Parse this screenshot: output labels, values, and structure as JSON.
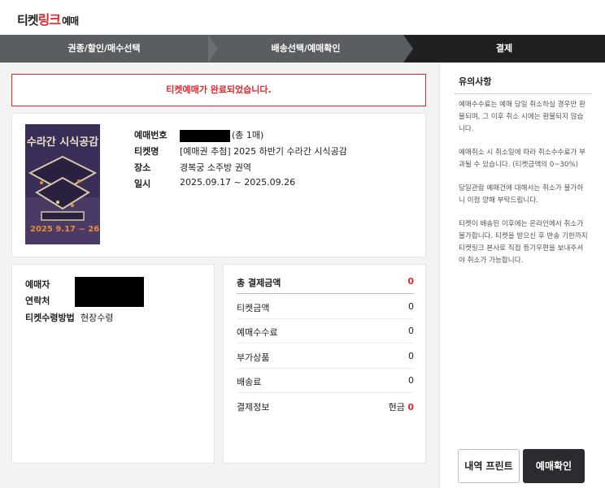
{
  "header": {
    "logo_part1": "티켓",
    "logo_part2": "링크",
    "logo_part3": "예매"
  },
  "steps": [
    {
      "label": "권종/할인/매수선택"
    },
    {
      "label": "배송선택/예매확인"
    },
    {
      "label": "결제"
    }
  ],
  "alert": "티켓예매가 완료되었습니다.",
  "ticket": {
    "booking_no_label": "예매번호",
    "booking_count": "(총 1매)",
    "name_label": "티켓명",
    "name_value": "[예매권 추첨] 2025 하반기 수라간 시식공감",
    "venue_label": "장소",
    "venue_value": "경복궁 소주방 권역",
    "date_label": "일시",
    "date_value": "2025.09.17 ~ 2025.09.26",
    "poster": {
      "title": "수라간 시식공감",
      "dates": "2025 9.17 ~ 26",
      "colors": {
        "bg": "#3a2e58",
        "accent": "#e98a3a"
      }
    }
  },
  "buyer": {
    "name_label": "예매자",
    "contact_label": "연락처",
    "method_label": "티켓수령방법",
    "method_value": "현장수령"
  },
  "payment": {
    "rows": [
      {
        "label": "총 결제금액",
        "value": "0"
      },
      {
        "label": "티켓금액",
        "value": "0"
      },
      {
        "label": "예매수수료",
        "value": "0"
      },
      {
        "label": "부가상품",
        "value": "0"
      },
      {
        "label": "배송료",
        "value": "0"
      }
    ],
    "method_label": "결제정보",
    "method_type": "현금",
    "method_amount": "0"
  },
  "notice": {
    "title": "유의사항",
    "items": [
      "예매수수료는 예매 당일 취소하실 경우만 환불되며, 그 이후 취소 시에는 환불되지 않습니다.",
      "예매취소 시 취소일에 따라 취소수수료가 부과될 수 있습니다. (티켓금액의 0~30%)",
      "당일관람 예매건에 대해서는 취소가 불가하니 이점 양해 부탁드립니다.",
      "티켓이 배송된 이후에는 온라인에서 취소가 불가합니다. 티켓을 받으신 후 반송 기한까지 티켓링크 본사로 직접 등기우편을 보내주셔야 취소가 가능합니다."
    ]
  },
  "buttons": {
    "print": "내역 프린트",
    "confirm": "예매확인"
  },
  "colors": {
    "accent": "#e1262d",
    "dark": "#1f2022",
    "step_bg": "#5a5d61"
  }
}
